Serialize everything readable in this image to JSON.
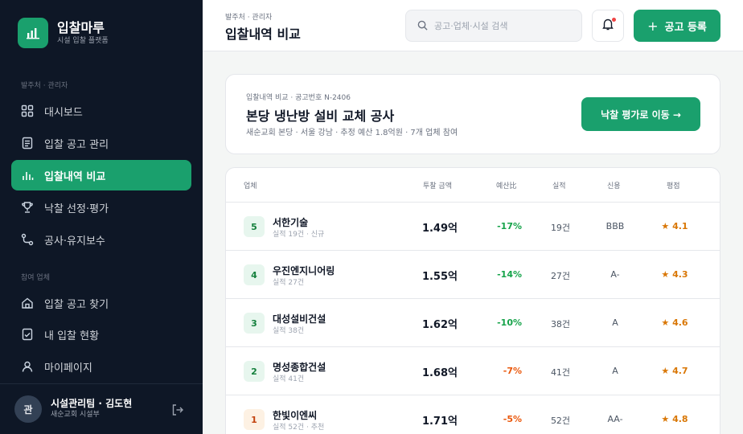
{
  "brand": {
    "name": "입찰마루",
    "subtitle": "시설 입찰 플랫폼"
  },
  "sidebar": {
    "section1": "발주처 · 관리자",
    "section2": "참여 업체",
    "items": [
      {
        "label": "대시보드",
        "icon": "dashboard-icon"
      },
      {
        "label": "입찰 공고 관리",
        "icon": "document-icon"
      },
      {
        "label": "입찰내역 비교",
        "icon": "bar-chart-icon",
        "active": true
      },
      {
        "label": "낙찰 선정·평가",
        "icon": "trophy-icon"
      },
      {
        "label": "공사·유지보수",
        "icon": "route-icon"
      },
      {
        "label": "입찰 공고 찾기",
        "icon": "home-icon"
      },
      {
        "label": "내 입찰 현황",
        "icon": "checklist-icon"
      },
      {
        "label": "마이페이지",
        "icon": "user-icon"
      }
    ]
  },
  "user": {
    "avatar": "관",
    "name": "시설관리팀 · 김도현",
    "org": "새순교회 시설부"
  },
  "header": {
    "breadcrumb": "발주처 · 관리자",
    "title": "입찰내역 비교",
    "search_placeholder": "공고·업체·시설 검색",
    "add_button": "공고 등록"
  },
  "summary": {
    "crumb": "입찰내역 비교 · 공고번호 N-2406",
    "title": "본당 냉난방 설비 교체 공사",
    "meta": "새순교회 본당 · 서울 강남 · 추정 예산 1.8억원 · 7개 업체 참여",
    "eval_button": "낙찰 평가로 이동 →"
  },
  "table": {
    "headers": {
      "company": "업체",
      "bid": "투찰 금액",
      "ratio": "예산比",
      "record": "실적",
      "credit": "신용",
      "rating": "평점"
    },
    "rows": [
      {
        "rank": "5",
        "name": "서한기술",
        "sub": "실적 19건 · 신규",
        "bid": "1.49억",
        "ratio": "-17%",
        "tone": "green",
        "record": "19건",
        "credit": "BBB",
        "rating": "★ 4.1"
      },
      {
        "rank": "4",
        "name": "우진엔지니어링",
        "sub": "실적 27건",
        "bid": "1.55억",
        "ratio": "-14%",
        "tone": "green",
        "record": "27건",
        "credit": "A-",
        "rating": "★ 4.3"
      },
      {
        "rank": "3",
        "name": "대성설비건설",
        "sub": "실적 38건",
        "bid": "1.62억",
        "ratio": "-10%",
        "tone": "green",
        "record": "38건",
        "credit": "A",
        "rating": "★ 4.6"
      },
      {
        "rank": "2",
        "name": "명성종합건설",
        "sub": "실적 41건",
        "bid": "1.68억",
        "ratio": "-7%",
        "tone": "orange",
        "record": "41건",
        "credit": "A",
        "rating": "★ 4.7"
      },
      {
        "rank": "1",
        "name": "한빛이엔씨",
        "sub": "실적 52건 · 추천",
        "bid": "1.71억",
        "ratio": "-5%",
        "tone": "orange",
        "record": "52건",
        "credit": "AA-",
        "rating": "★ 4.8"
      }
    ]
  },
  "colors": {
    "accent": "#1aa06d",
    "sidebar_bg": "#0e1726",
    "green_text": "#16a34a",
    "orange_text": "#ea580c",
    "star": "#d97706"
  }
}
